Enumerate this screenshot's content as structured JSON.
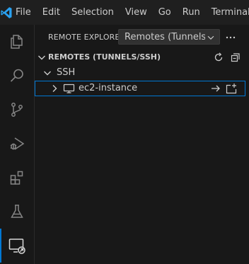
{
  "menubar": {
    "logo_icon": "vscode-logo-icon",
    "items": [
      "File",
      "Edit",
      "Selection",
      "View",
      "Go",
      "Run",
      "Terminal"
    ]
  },
  "activitybar": {
    "items": [
      {
        "icon": "explorer-files-icon",
        "active": false
      },
      {
        "icon": "search-icon",
        "active": false
      },
      {
        "icon": "source-control-icon",
        "active": false
      },
      {
        "icon": "run-debug-icon",
        "active": false
      },
      {
        "icon": "extensions-icon",
        "active": false
      },
      {
        "icon": "testing-flask-icon",
        "active": false
      },
      {
        "icon": "remote-explorer-icon",
        "active": true
      }
    ]
  },
  "sidebar": {
    "title": "REMOTE EXPLORER",
    "remote_select": {
      "value": "Remotes (Tunnels/"
    },
    "more_icon": "ellipsis-icon",
    "section": {
      "title": "REMOTES (TUNNELS/SSH)",
      "refresh_icon": "refresh-icon",
      "collapse_icon": "collapse-all-icon"
    },
    "tree": {
      "group_label": "SSH",
      "host": {
        "label": "ec2-instance",
        "icon": "vm-monitor-icon",
        "actions": [
          "connect-in-current-window-icon",
          "connect-in-new-window-icon"
        ]
      }
    }
  },
  "colors": {
    "background": "#181818",
    "accent": "#0078d4",
    "text": "#cccccc",
    "logo_blue": "#2aa1f0"
  }
}
